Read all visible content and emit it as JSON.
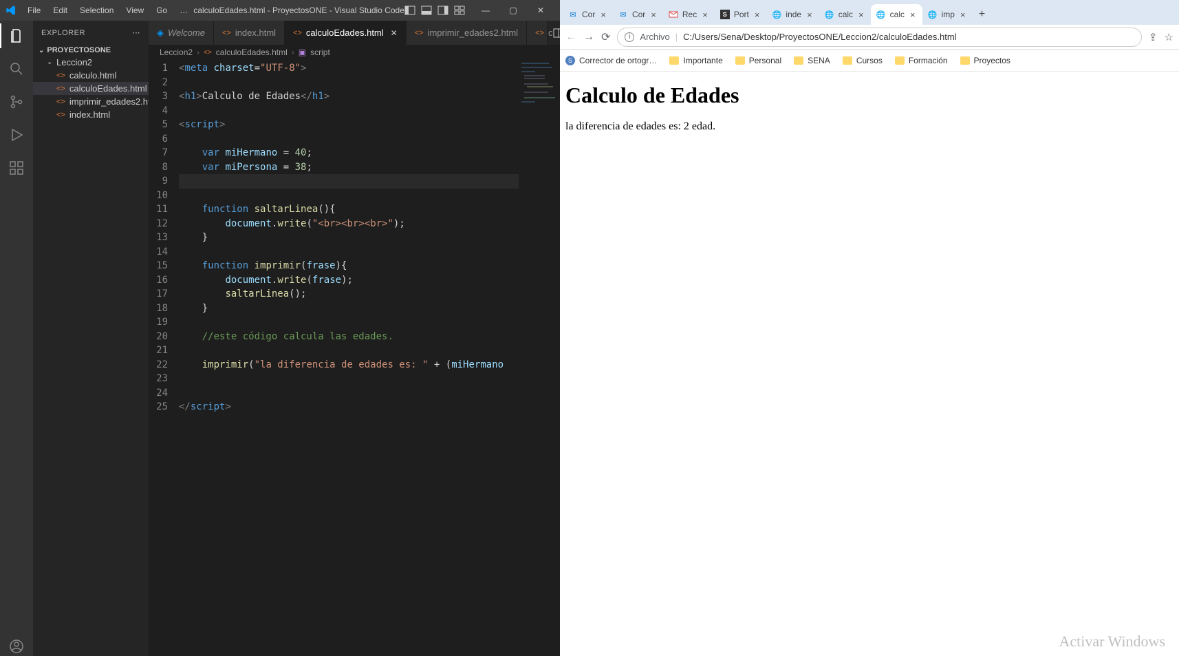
{
  "vscode": {
    "menus": [
      "File",
      "Edit",
      "Selection",
      "View",
      "Go"
    ],
    "menu_more": "…",
    "title": "calculoEdades.html - ProyectosONE - Visual Studio Code",
    "explorer_label": "EXPLORER",
    "project_name": "PROYECTOSONE",
    "folder": "Leccion2",
    "files": [
      "calculo.html",
      "calculoEdades.html",
      "imprimir_edades2.html",
      "index.html"
    ],
    "selected_file_index": 1,
    "tabs": [
      {
        "label": "Welcome",
        "icon": "vs",
        "active": false
      },
      {
        "label": "index.html",
        "icon": "html",
        "active": false
      },
      {
        "label": "calculoEdades.html",
        "icon": "html",
        "active": true
      },
      {
        "label": "imprimir_edades2.html",
        "icon": "html",
        "active": false
      },
      {
        "label": "c",
        "icon": "html",
        "active": false
      }
    ],
    "breadcrumb": [
      "Leccion2",
      "calculoEdades.html",
      "script"
    ],
    "line_numbers": [
      "1",
      "2",
      "3",
      "4",
      "5",
      "6",
      "7",
      "8",
      "9",
      "10",
      "11",
      "12",
      "13",
      "14",
      "15",
      "16",
      "17",
      "18",
      "19",
      "20",
      "21",
      "22",
      "23",
      "24",
      "25"
    ],
    "code_tokens": {
      "l1": {
        "charset": "charset",
        "utf": "\"UTF-8\""
      },
      "l3": {
        "title": "Calculo de Edades"
      },
      "l7": {
        "name": "miHermano",
        "val": "40"
      },
      "l8": {
        "name": "miPersona",
        "val": "38"
      },
      "l11": {
        "fn": "saltarLinea"
      },
      "l12": {
        "str": "\"<br><br><br>\""
      },
      "l15": {
        "fn": "imprimir",
        "arg": "frase"
      },
      "l16": {
        "arg": "frase"
      },
      "l17": {
        "fn": "saltarLinea"
      },
      "l20": {
        "cm": "//este código calcula las edades."
      },
      "l22": {
        "fn": "imprimir",
        "str": "\"la diferencia de edades es: \"",
        "var": "miHermano"
      }
    }
  },
  "browser": {
    "tabs": [
      {
        "fav": "outlook",
        "label": "Cor"
      },
      {
        "fav": "outlook",
        "label": "Cor"
      },
      {
        "fav": "gmail",
        "label": "Rec"
      },
      {
        "fav": "s",
        "label": "Port"
      },
      {
        "fav": "globe",
        "label": "inde"
      },
      {
        "fav": "globe",
        "label": "calc"
      },
      {
        "fav": "globe",
        "label": "calc",
        "active": true
      },
      {
        "fav": "globe",
        "label": "imp"
      }
    ],
    "url_hint": "Archivo",
    "url": "C:/Users/Sena/Desktop/ProyectosONE/Leccion2/calculoEdades.html",
    "bookmarks": [
      {
        "icon": "s",
        "label": "Corrector de ortogr…"
      },
      {
        "icon": "fld",
        "label": "Importante"
      },
      {
        "icon": "fld",
        "label": "Personal"
      },
      {
        "icon": "fld",
        "label": "SENA"
      },
      {
        "icon": "fld",
        "label": "Cursos"
      },
      {
        "icon": "fld",
        "label": "Formación"
      },
      {
        "icon": "fld",
        "label": "Proyectos"
      }
    ],
    "page_title": "Calculo de Edades",
    "page_text": "la diferencia de edades es: 2 edad.",
    "watermark": "Activar Windows"
  }
}
